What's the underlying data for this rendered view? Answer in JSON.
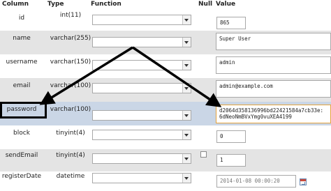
{
  "columns": {
    "column": "Column",
    "type": "Type",
    "function": "Function",
    "null": "Null",
    "value": "Value"
  },
  "rows": [
    {
      "name": "id",
      "type": "int(11)",
      "value": "865"
    },
    {
      "name": "name",
      "type": "varchar(255)",
      "value": "Super User"
    },
    {
      "name": "username",
      "type": "varchar(150)",
      "value": "admin"
    },
    {
      "name": "email",
      "type": "varchar(100)",
      "value": "admin@example.com"
    },
    {
      "name": "password",
      "type": "varchar(100)",
      "value": "d2064d358136996bd22421584a7cb33e:\n6dNeoNmBVxYmg0vuXEA4199"
    },
    {
      "name": "block",
      "type": "tinyint(4)",
      "value": "0"
    },
    {
      "name": "sendEmail",
      "type": "tinyint(4)",
      "value": "1"
    },
    {
      "name": "registerDate",
      "type": "datetime",
      "value": "2014-01-08 00:00:20"
    }
  ],
  "colors": {
    "highlight_row": "#cad6e6",
    "alt_row": "#e4e4e4",
    "arrow": "#000000",
    "calendar_icon": "calendar-icon"
  }
}
